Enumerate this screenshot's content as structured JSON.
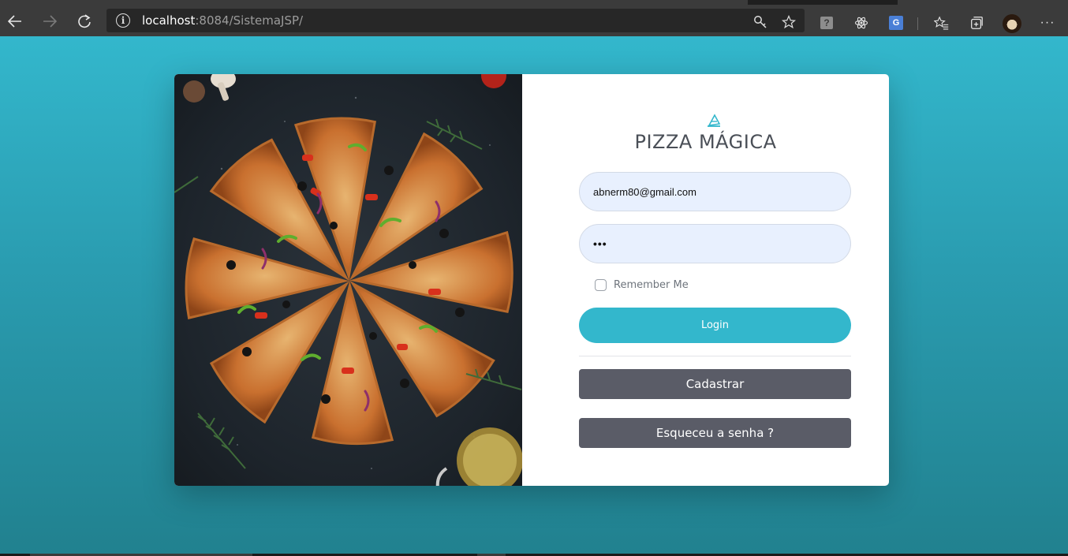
{
  "browser": {
    "url_host": "localhost",
    "url_rest": ":8084/SistemaJSP/",
    "icons": [
      "back-arrow-icon",
      "forward-arrow-icon",
      "refresh-icon",
      "info-icon",
      "key-icon",
      "star-icon",
      "help-extension-icon",
      "react-extension-icon",
      "translate-extension-icon",
      "favorites-icon",
      "collections-icon",
      "profile-avatar",
      "more-icon"
    ],
    "ext_help_glyph": "?",
    "ext_translate_glyph": "G",
    "more_glyph": "···"
  },
  "colors": {
    "accent": "#33b7cc",
    "secondary_button": "#5a5c67",
    "input_bg": "#e8f0fe"
  },
  "login": {
    "brand": "PIZZA MÁGICA",
    "email_value": "abnerm80@gmail.com",
    "password_value": "•••",
    "remember_label": "Remember Me",
    "login_button": "Login",
    "register_button": "Cadastrar",
    "forgot_button": "Esqueceu a senha ?"
  }
}
